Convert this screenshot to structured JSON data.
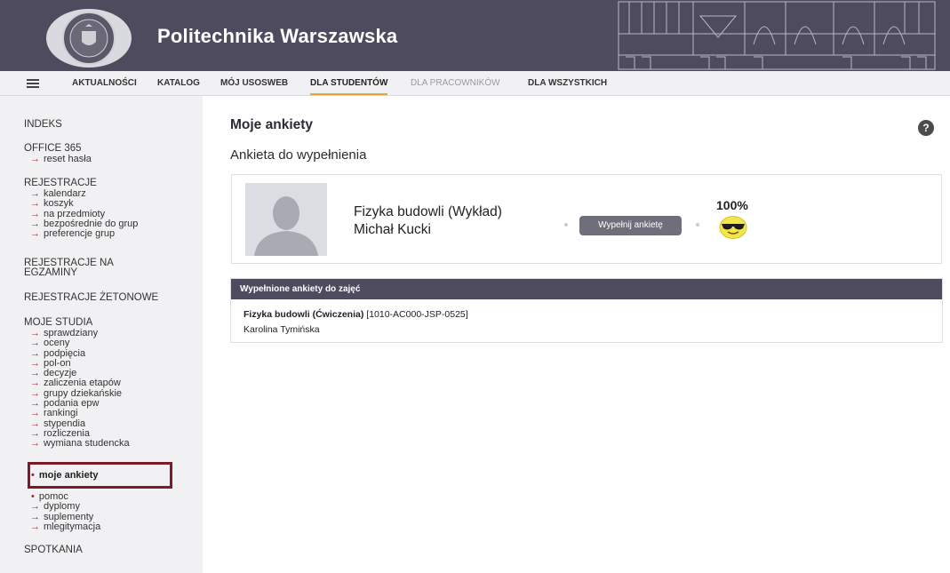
{
  "header": {
    "brand": "Politechnika Warszawska"
  },
  "nav": {
    "items": [
      {
        "label": "AKTUALNOŚCI"
      },
      {
        "label": "KATALOG"
      },
      {
        "label": "MÓJ USOSWEB"
      },
      {
        "label": "DLA STUDENTÓW",
        "active": true
      },
      {
        "label": "DLA PRACOWNIKÓW",
        "disabled": true
      },
      {
        "label": "DLA WSZYSTKICH"
      }
    ]
  },
  "sidebar": {
    "indeks": "INDEKS",
    "office": "OFFICE 365",
    "office_items": [
      "reset hasła"
    ],
    "rejestracje": "REJESTRACJE",
    "rejestracje_items": [
      "kalendarz",
      "koszyk",
      "na przedmioty",
      "bezpośrednie do grup",
      "preferencje grup"
    ],
    "rej_egz_1": "REJESTRACJE NA",
    "rej_egz_2": "EGZAMINY",
    "rej_zet": "REJESTRACJE ŻETONOWE",
    "moje_studia": "MOJE STUDIA",
    "moje_studia_items": [
      "sprawdziany",
      "oceny",
      "podpięcia",
      "pol-on",
      "decyzje",
      "zaliczenia etapów",
      "grupy dziekańskie",
      "podania epw",
      "rankingi",
      "stypendia",
      "rozliczenia",
      "wymiana studencka"
    ],
    "moje_ankiety": "moje ankiety",
    "pomoc": "pomoc",
    "after_items": [
      "dyplomy",
      "suplementy",
      "mlegitymacja"
    ],
    "spotkania": "SPOTKANIA"
  },
  "main": {
    "title": "Moje ankiety",
    "help": "?",
    "subtitle": "Ankieta do wypełnienia",
    "card": {
      "course": "Fizyka budowli (Wykład)",
      "teacher": "Michał Kucki",
      "button": "Wypełnij ankietę",
      "percent": "100%"
    },
    "filled": {
      "heading": "Wypełnione ankiety do zajęć",
      "course_name": "Fizyka budowli (Ćwiczenia)",
      "course_code": " [1010-AC000-JSP-0525]",
      "teacher": "Karolina Tymińska"
    }
  },
  "colors": {
    "header_bg": "#4f4b5f",
    "accent": "#a3262d",
    "nav_active_underline": "#e8a23a",
    "highlight_border": "#7b1b2a"
  }
}
